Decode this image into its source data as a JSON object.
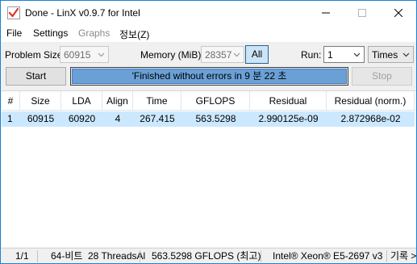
{
  "window": {
    "title": "Done - LinX v0.9.7 for Intel"
  },
  "menu": {
    "file": "File",
    "settings": "Settings",
    "graphs": "Graphs",
    "info": "정보(Z)"
  },
  "controls": {
    "problem_size_label": "Problem Size:",
    "problem_size_value": "60915",
    "memory_label": "Memory (MiB):",
    "memory_value": "28357",
    "all_button": "All",
    "run_label": "Run:",
    "run_value": "1",
    "run_unit": "Times",
    "start_button": "Start",
    "stop_button": "Stop",
    "status_text": "'Finished without errors in 9 분 22 초",
    "progress_fraction": 1.0
  },
  "table": {
    "columns": [
      "#",
      "Size",
      "LDA",
      "Align",
      "Time",
      "GFLOPS",
      "Residual",
      "Residual (norm.)"
    ],
    "rows": [
      [
        "1",
        "60915",
        "60920",
        "4",
        "267.415",
        "563.5298",
        "2.990125e-09",
        "2.872968e-02"
      ]
    ]
  },
  "statusbar": {
    "count": "1/1",
    "bits": "64-비트",
    "threads": "28 ThreadsAl",
    "gflops": "563.5298 GFLOPS (최고)",
    "cpu": "Intel® Xeon® E5-2697 v3",
    "log": "기록 >"
  },
  "colors": {
    "accent": "#1883d7",
    "progress": "#6aa0d6",
    "selected_row": "#cce8ff"
  }
}
